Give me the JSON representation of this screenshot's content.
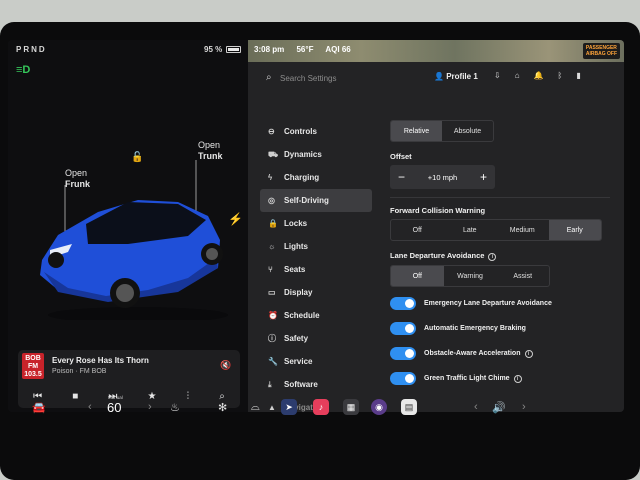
{
  "vehicle": {
    "gear": "PRND",
    "battery_percent": "95 %",
    "open_frunk_line1": "Open",
    "open_frunk_line2": "Frunk",
    "open_trunk_line1": "Open",
    "open_trunk_line2": "Trunk"
  },
  "media": {
    "station_line1": "BOB",
    "station_line2": "FM",
    "station_line3": "103.5",
    "title": "Every Rose Has Its Thorn",
    "subtitle": "Poison · FM BOB"
  },
  "status": {
    "time": "3:08 pm",
    "temperature": "56°F",
    "aqi": "AQI 66",
    "airbag_line1": "PASSENGER",
    "airbag_line2": "AIRBAG OFF"
  },
  "header": {
    "search_placeholder": "Search Settings",
    "profile": "Profile 1"
  },
  "nav": {
    "items": [
      {
        "label": "Controls",
        "icon": "toggle-icon"
      },
      {
        "label": "Dynamics",
        "icon": "car-icon"
      },
      {
        "label": "Charging",
        "icon": "bolt-icon"
      },
      {
        "label": "Self-Driving",
        "icon": "steering-wheel-icon"
      },
      {
        "label": "Locks",
        "icon": "lock-icon"
      },
      {
        "label": "Lights",
        "icon": "sun-icon"
      },
      {
        "label": "Seats",
        "icon": "seat-icon"
      },
      {
        "label": "Display",
        "icon": "display-icon"
      },
      {
        "label": "Schedule",
        "icon": "clock-icon"
      },
      {
        "label": "Safety",
        "icon": "info-circle-icon"
      },
      {
        "label": "Service",
        "icon": "wrench-icon"
      },
      {
        "label": "Software",
        "icon": "download-icon"
      },
      {
        "label": "Navigation",
        "icon": "navigation-icon"
      }
    ],
    "active": "Self-Driving"
  },
  "self_driving": {
    "mode_options": [
      "Relative",
      "Absolute"
    ],
    "mode_selected": "Relative",
    "offset_label": "Offset",
    "offset_value": "+10 mph",
    "fcw_label": "Forward Collision Warning",
    "fcw_options": [
      "Off",
      "Late",
      "Medium",
      "Early"
    ],
    "fcw_selected": "Early",
    "lda_label": "Lane Departure Avoidance",
    "lda_options": [
      "Off",
      "Warning",
      "Assist"
    ],
    "lda_selected": "Off",
    "toggles": [
      {
        "label": "Emergency Lane Departure Avoidance",
        "on": true
      },
      {
        "label": "Automatic Emergency Braking",
        "on": true
      },
      {
        "label": "Obstacle-Aware Acceleration",
        "on": true
      },
      {
        "label": "Green Traffic Light Chime",
        "on": true
      }
    ]
  },
  "dock": {
    "speed_mode": "Manual",
    "speed": "60"
  },
  "colors": {
    "accent": "#2f8ff0",
    "car_blue": "#1f4fd8",
    "headlight_green": "#35c65a",
    "station_red": "#c8232a"
  }
}
